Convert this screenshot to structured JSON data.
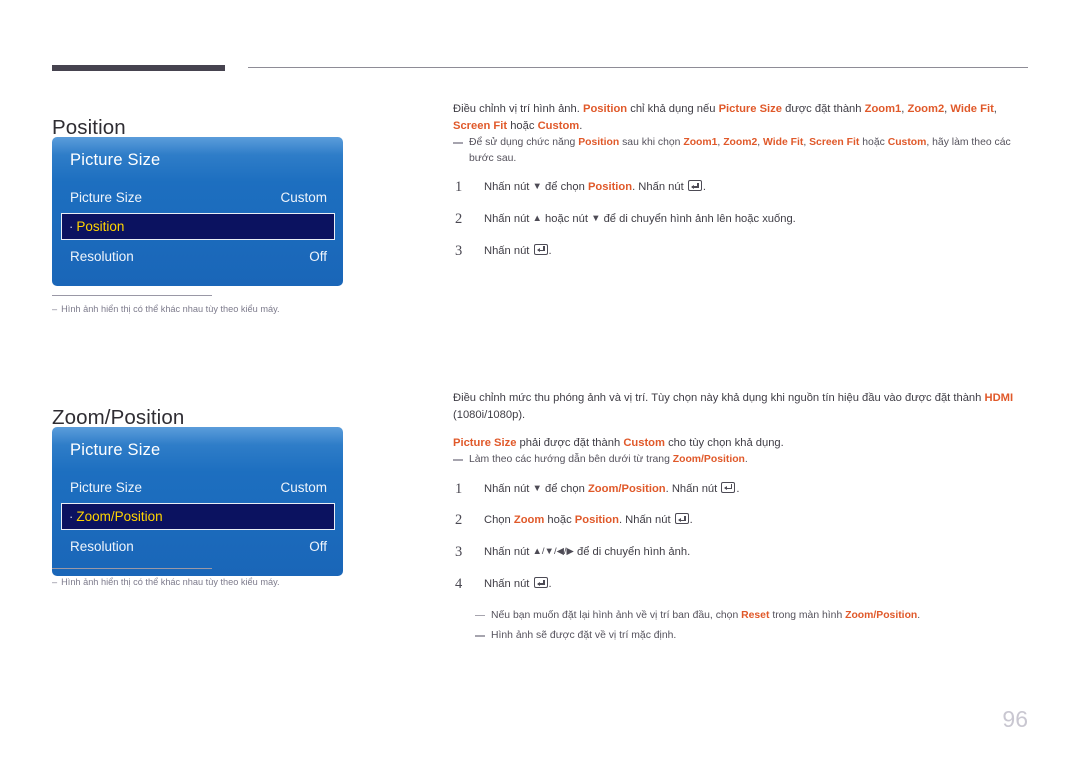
{
  "page": {
    "number": "96"
  },
  "sections": [
    {
      "id": "position",
      "heading": "Position",
      "osd": {
        "title": "Picture Size",
        "rows": [
          {
            "label": "Picture Size",
            "value": "Custom",
            "selected": false
          },
          {
            "label": "Position",
            "value": "",
            "selected": true
          },
          {
            "label": "Resolution",
            "value": "Off",
            "selected": false
          }
        ]
      },
      "osd_note": "Hình ảnh hiển thị có thể khác nhau tùy theo kiểu máy.",
      "intro": {
        "p1_a": "Điều chỉnh vị trí hình ảnh. ",
        "p1_kw1": "Position",
        "p1_b": " chỉ khả dụng nếu ",
        "p1_kw2": "Picture Size",
        "p1_c": " được đặt thành ",
        "p1_kw3": "Zoom1",
        "p1_d": ", ",
        "p1_kw4": "Zoom2",
        "p1_e": ", ",
        "p1_kw5": "Wide Fit",
        "p1_f": ", ",
        "p1_kw6": "Screen Fit",
        "p1_g": " hoặc ",
        "p1_kw7": "Custom",
        "p1_h": "."
      },
      "note": {
        "a": "Để sử dụng chức năng ",
        "kw1": "Position",
        "b": " sau khi chọn ",
        "kw2": "Zoom1",
        "c": ", ",
        "kw3": "Zoom2",
        "d": ", ",
        "kw4": "Wide Fit",
        "e": ", ",
        "kw5": "Screen Fit",
        "f": " hoặc ",
        "kw6": "Custom",
        "g": ", hãy làm theo các bước sau."
      },
      "steps": [
        {
          "num": "1",
          "a": "Nhấn nút ",
          "arrow": "▼",
          "b": " để chọn ",
          "kw": "Position",
          "c": ". Nhấn nút ",
          "d": "."
        },
        {
          "num": "2",
          "a": "Nhấn nút ",
          "arrow": "▲",
          "b": " hoặc nút ",
          "arrow2": "▼",
          "c": " để di chuyển hình ảnh lên hoặc xuống."
        },
        {
          "num": "3",
          "a": "Nhấn nút ",
          "d": "."
        }
      ]
    },
    {
      "id": "zoom-position",
      "heading": "Zoom/Position",
      "osd": {
        "title": "Picture Size",
        "rows": [
          {
            "label": "Picture Size",
            "value": "Custom",
            "selected": false
          },
          {
            "label": "Zoom/Position",
            "value": "",
            "selected": true
          },
          {
            "label": "Resolution",
            "value": "Off",
            "selected": false
          }
        ]
      },
      "osd_note": "Hình ảnh hiển thị có thể khác nhau tùy theo kiểu máy.",
      "intro": {
        "p1_a": "Điều chỉnh mức thu phóng ảnh và vị trí. Tùy chọn này khả dụng khi nguồn tín hiệu đầu vào được đặt thành ",
        "p1_kw1": "HDMI",
        "p1_b": " (1080i/1080p).",
        "p2_kw1": "Picture Size",
        "p2_a": " phải được đặt thành ",
        "p2_kw2": "Custom",
        "p2_b": " cho tùy chọn khả dụng."
      },
      "note": {
        "a": "Làm theo các hướng dẫn bên dưới từ trang ",
        "kw1": "Zoom/Position",
        "b": "."
      },
      "steps": [
        {
          "num": "1",
          "a": "Nhấn nút ",
          "arrow": "▼",
          "b": " để chọn ",
          "kw": "Zoom/Position",
          "c": ". Nhấn nút ",
          "d": "."
        },
        {
          "num": "2",
          "a": "Chọn ",
          "kw": "Zoom",
          "b": " hoặc ",
          "kw2": "Position",
          "c": ". Nhấn nút ",
          "d": "."
        },
        {
          "num": "3",
          "a": "Nhấn nút ",
          "arrows": "▲/▼/◀/▶",
          "c": " để di chuyển hình ảnh."
        },
        {
          "num": "4",
          "a": "Nhấn nút ",
          "d": "."
        }
      ],
      "end_notes": [
        {
          "a": "Nếu bạn muốn đặt lại hình ảnh về vị trí ban đầu, chọn ",
          "kw1": "Reset",
          "b": " trong màn hình ",
          "kw2": "Zoom/Position",
          "c": "."
        },
        {
          "a": "Hình ảnh sẽ được đặt về vị trí mặc định."
        }
      ]
    }
  ]
}
